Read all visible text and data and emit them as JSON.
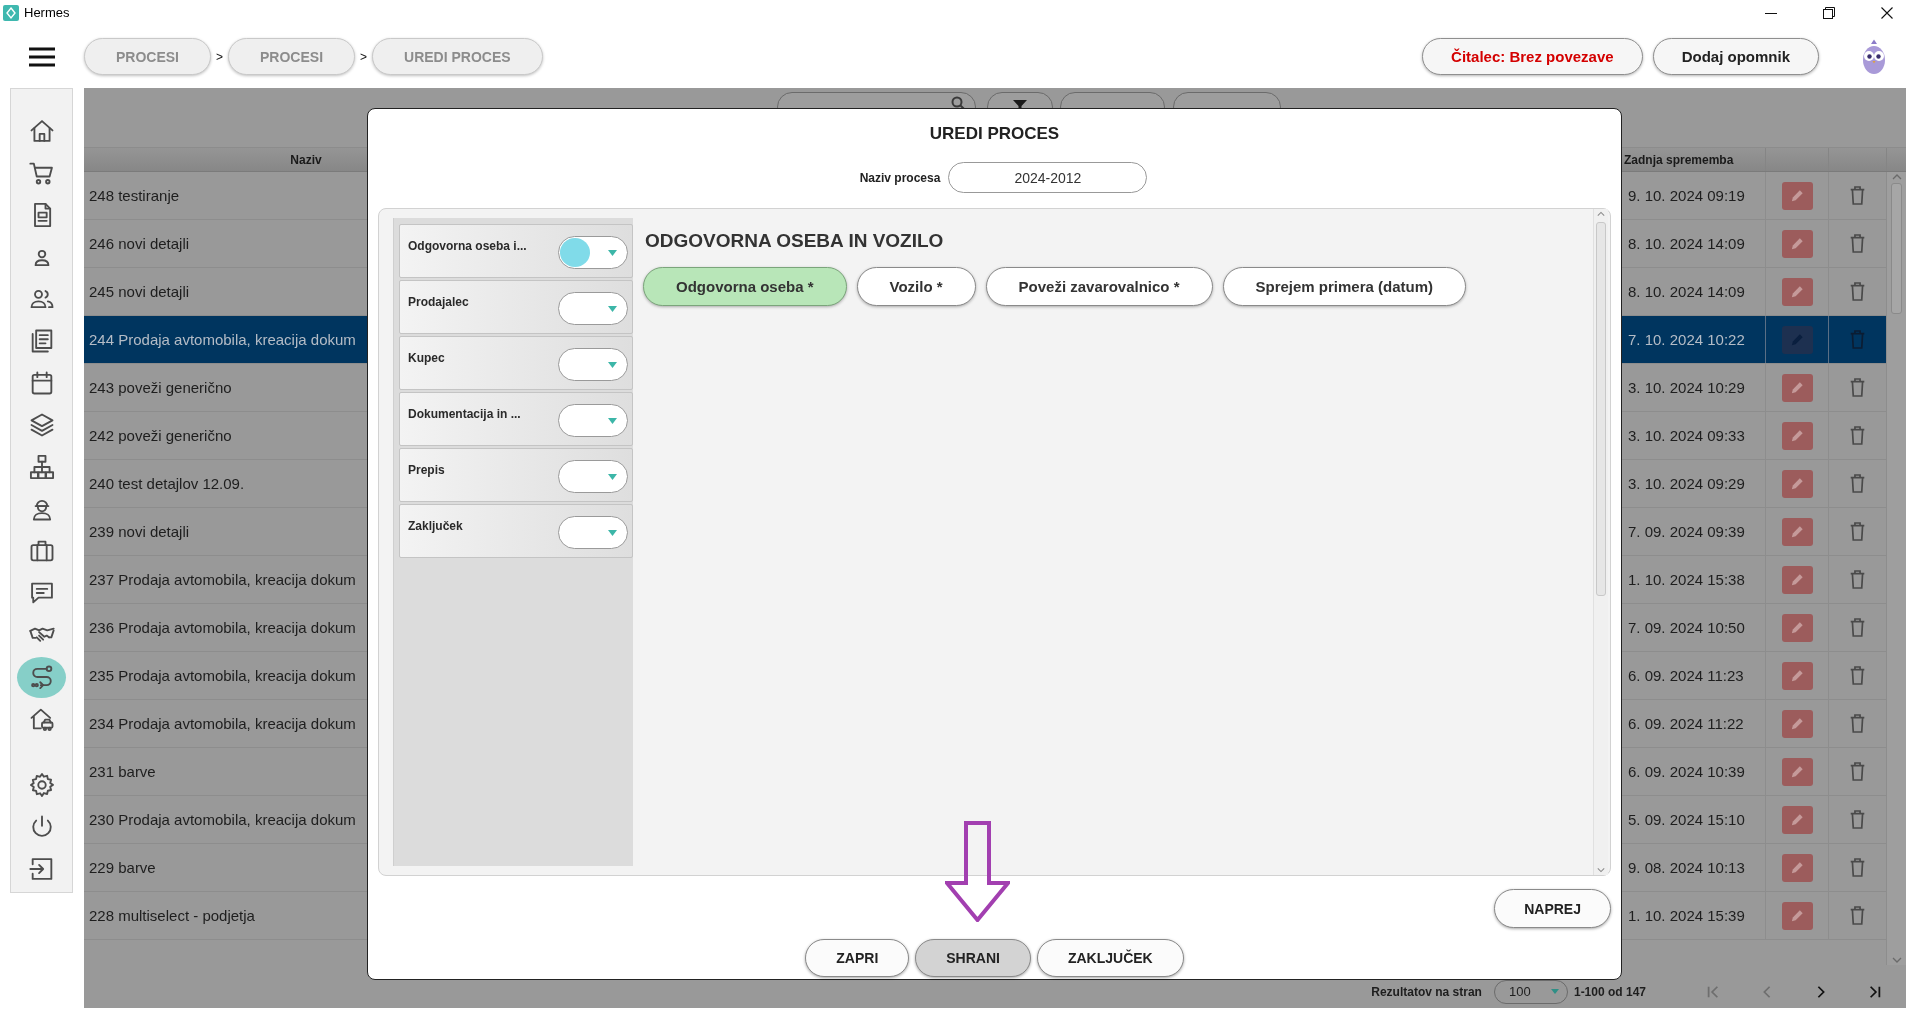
{
  "window": {
    "title": "Hermes"
  },
  "header": {
    "breadcrumbs": [
      {
        "label": "PROCESI",
        "separator": ">"
      },
      {
        "label": "PROCESI",
        "separator": ">"
      },
      {
        "label": "UREDI PROCES"
      }
    ],
    "reader_status": "Čitalec: Brez povezave",
    "reminder_button": "Dodaj opomnik"
  },
  "sidebar": {
    "groups": [
      {
        "items": [
          {
            "selected": false
          },
          {
            "selected": false
          },
          {
            "selected": false
          },
          {
            "selected": false
          },
          {
            "selected": false
          },
          {
            "selected": false
          },
          {
            "selected": false
          },
          {
            "selected": false
          },
          {
            "selected": false
          },
          {
            "selected": false
          },
          {
            "selected": false
          },
          {
            "selected": false
          },
          {
            "selected": false
          },
          {
            "selected": true
          },
          {
            "selected": false
          }
        ]
      },
      {
        "items": [
          {
            "selected": false
          },
          {
            "selected": false
          },
          {
            "selected": false
          }
        ]
      }
    ]
  },
  "table": {
    "columns": [
      {
        "label": "Naziv"
      },
      {
        "label": "Zadnja sprememba"
      }
    ],
    "rows": [
      {
        "name": "248 testiranje",
        "modified": "9. 10. 2024 09:19",
        "selected": false
      },
      {
        "name": "246 novi detajli",
        "modified": "8. 10. 2024 14:09",
        "selected": false
      },
      {
        "name": "245 novi detajli",
        "modified": "8. 10. 2024 14:09",
        "selected": false
      },
      {
        "name": "244 Prodaja avtomobila, kreacija dokum",
        "modified": "7. 10. 2024 10:22",
        "selected": true
      },
      {
        "name": "243 poveži generično",
        "modified": "3. 10. 2024 10:29",
        "selected": false
      },
      {
        "name": "242 poveži generično",
        "modified": "3. 10. 2024 09:33",
        "selected": false
      },
      {
        "name": "240 test detajlov 12.09.",
        "modified": "3. 10. 2024 09:29",
        "selected": false
      },
      {
        "name": "239 novi detajli",
        "modified": "7. 09. 2024 09:39",
        "selected": false
      },
      {
        "name": "237 Prodaja avtomobila, kreacija dokum",
        "modified": "1. 10. 2024 15:38",
        "selected": false
      },
      {
        "name": "236 Prodaja avtomobila, kreacija dokum",
        "modified": "7. 09. 2024 10:50",
        "selected": false
      },
      {
        "name": "235 Prodaja avtomobila, kreacija dokum",
        "modified": "6. 09. 2024 11:23",
        "selected": false
      },
      {
        "name": "234 Prodaja avtomobila, kreacija dokum",
        "modified": "6. 09. 2024 11:22",
        "selected": false
      },
      {
        "name": "231 barve",
        "modified": "6. 09. 2024 10:39",
        "selected": false
      },
      {
        "name": "230 Prodaja avtomobila, kreacija dokum",
        "modified": "5. 09. 2024 15:10",
        "selected": false
      },
      {
        "name": "229 barve",
        "modified": "9. 08. 2024 10:13",
        "selected": false
      },
      {
        "name": "228 multiselect - podjetja",
        "modified": "1. 10. 2024 15:39",
        "selected": false
      }
    ]
  },
  "pagination": {
    "label": "Rezultatov na stran",
    "page_size": "100",
    "range": "1-100 od 147",
    "buttons": [
      {
        "kind": "first",
        "disabled": true
      },
      {
        "kind": "prev",
        "disabled": true
      },
      {
        "kind": "next",
        "disabled": false
      },
      {
        "kind": "last",
        "disabled": false
      }
    ]
  },
  "dialog": {
    "title": "UREDI PROCES",
    "name_field": {
      "label": "Naziv procesa",
      "value": "2024-2012"
    },
    "steps": [
      {
        "label": "Odgovorna oseba i...",
        "selected": true
      },
      {
        "label": "Prodajalec",
        "selected": false
      },
      {
        "label": "Kupec",
        "selected": false
      },
      {
        "label": "Dokumentacija in ...",
        "selected": false
      },
      {
        "label": "Prepis",
        "selected": false
      },
      {
        "label": "Zaključek",
        "selected": false
      }
    ],
    "section_title": "ODGOVORNA OSEBA IN VOZILO",
    "subtabs": [
      {
        "label": "Odgovorna oseba *",
        "selected": true
      },
      {
        "label": "Vozilo *",
        "selected": false
      },
      {
        "label": "Poveži zavarovalnico *",
        "selected": false
      },
      {
        "label": "Sprejem primera (datum)",
        "selected": false
      }
    ],
    "next_button": "NAPREJ",
    "buttons": [
      {
        "label": "ZAPRI",
        "highlighted": false
      },
      {
        "label": "SHRANI",
        "highlighted": true
      },
      {
        "label": "ZAKLJUČEK",
        "highlighted": false
      }
    ]
  }
}
